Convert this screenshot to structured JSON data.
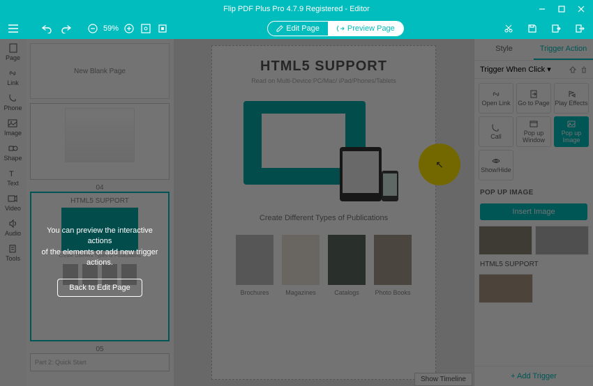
{
  "title": "Flip PDF Plus Pro 4.7.9 Registered  -  Editor",
  "toolbar": {
    "zoom": "59%",
    "edit_page": "Edit Page",
    "preview_page": "Preview Page"
  },
  "leftbar": {
    "items": [
      "Page",
      "Link",
      "Phone",
      "Image",
      "Shape",
      "Text",
      "Video",
      "Audio",
      "Tools"
    ]
  },
  "thumbs": {
    "blank": "New Blank Page",
    "n04": "04",
    "n05": "05",
    "th05_title": "HTML5 SUPPORT",
    "th05_sub": "Create Different Types of Publications",
    "n06_label": "Part 2: Quick Start"
  },
  "canvas": {
    "h1": "HTML5 SUPPORT",
    "sub": "Read on Multi-Device:PC/Mac/ iPad/Phones/Tablets",
    "subtitle2": "Create Different Types of Publications",
    "cards": [
      "Brochures",
      "Magazines",
      "Catalogs",
      "Photo Books"
    ],
    "show_timeline": "Show Timeline"
  },
  "overlay": {
    "tip1": "You can preview the interactive actions",
    "tip2": "of the elements or add new trigger actions.",
    "back": "Back to Edit Page"
  },
  "panel": {
    "tab_style": "Style",
    "tab_trigger": "Trigger Action",
    "trigger_when": "Trigger When Click",
    "actions": {
      "open_link": "Open Link",
      "goto_page": "Go to Page",
      "play_effects": "Play Effects",
      "call": "Call",
      "popup_window": "Pop up Window",
      "popup_image": "Pop up Image",
      "showhide": "Show/Hide"
    },
    "section": "POP UP IMAGE",
    "insert": "Insert Image",
    "thumb_label": "HTML5 SUPPORT",
    "add_trigger": "+ Add Trigger"
  },
  "card_colors": [
    "#c0bfbf",
    "#e8e2da",
    "#5b6b5f",
    "#a59a8a"
  ]
}
